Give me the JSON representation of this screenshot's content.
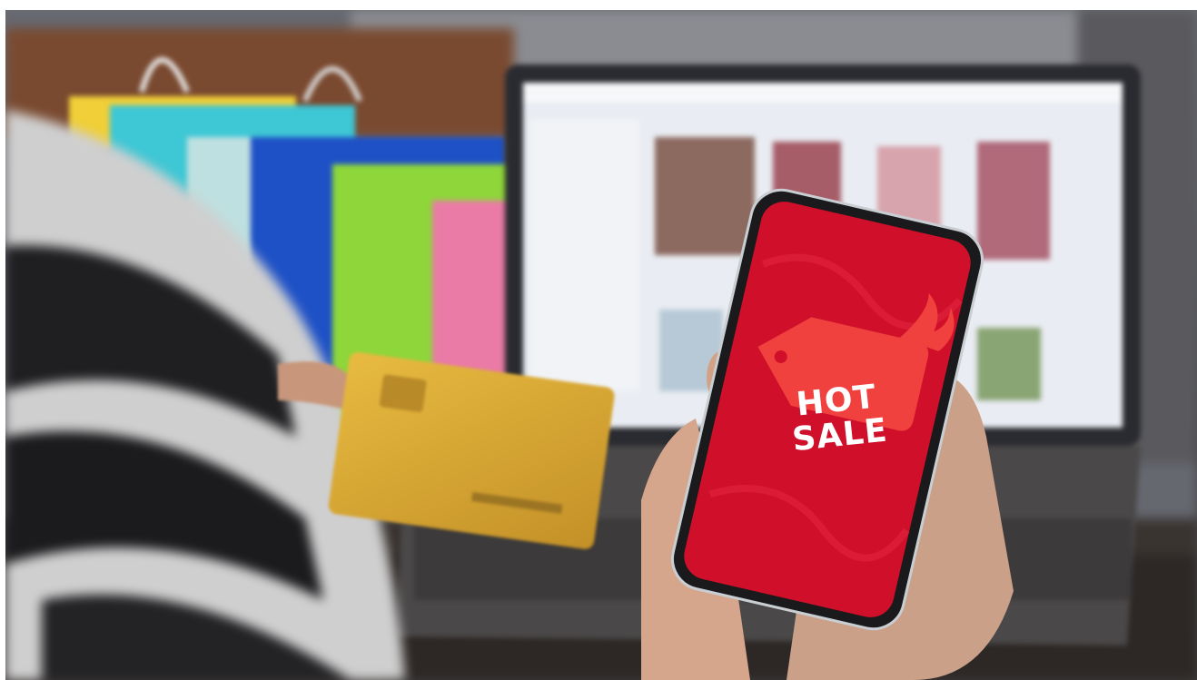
{
  "photo": {
    "phone_screen": {
      "tag_line1": "HOT",
      "tag_line2": "SALE",
      "screen_color": "#d0102a",
      "tag_color": "#f0413f"
    },
    "palette": {
      "wall": "#6b6d72",
      "laptop_screen": "#e9ecf2",
      "card": "#e0b032",
      "bags": [
        "#f4d13a",
        "#3fc6d6",
        "#1b4fc8",
        "#8ed13a",
        "#e97aa5"
      ]
    }
  }
}
